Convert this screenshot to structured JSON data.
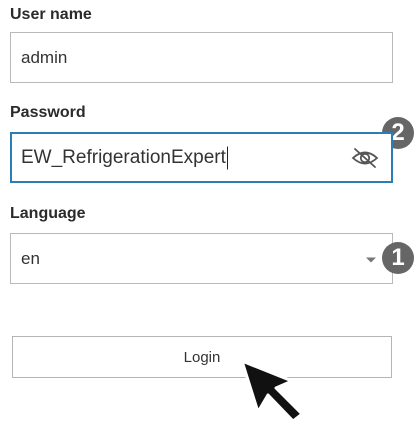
{
  "form": {
    "username": {
      "label": "User name",
      "value": "admin"
    },
    "password": {
      "label": "Password",
      "value": "EW_RefrigerationExpert"
    },
    "language": {
      "label": "Language",
      "selected": "en"
    },
    "login_label": "Login"
  },
  "annotations": {
    "marker_password": "2",
    "marker_language": "1"
  },
  "icons": {
    "password_toggle": "eye-slash-icon",
    "dropdown": "chevron-down-icon",
    "pointer": "mouse-cursor-icon"
  },
  "colors": {
    "focus_border": "#2c7db3",
    "marker_fill": "#666666"
  }
}
